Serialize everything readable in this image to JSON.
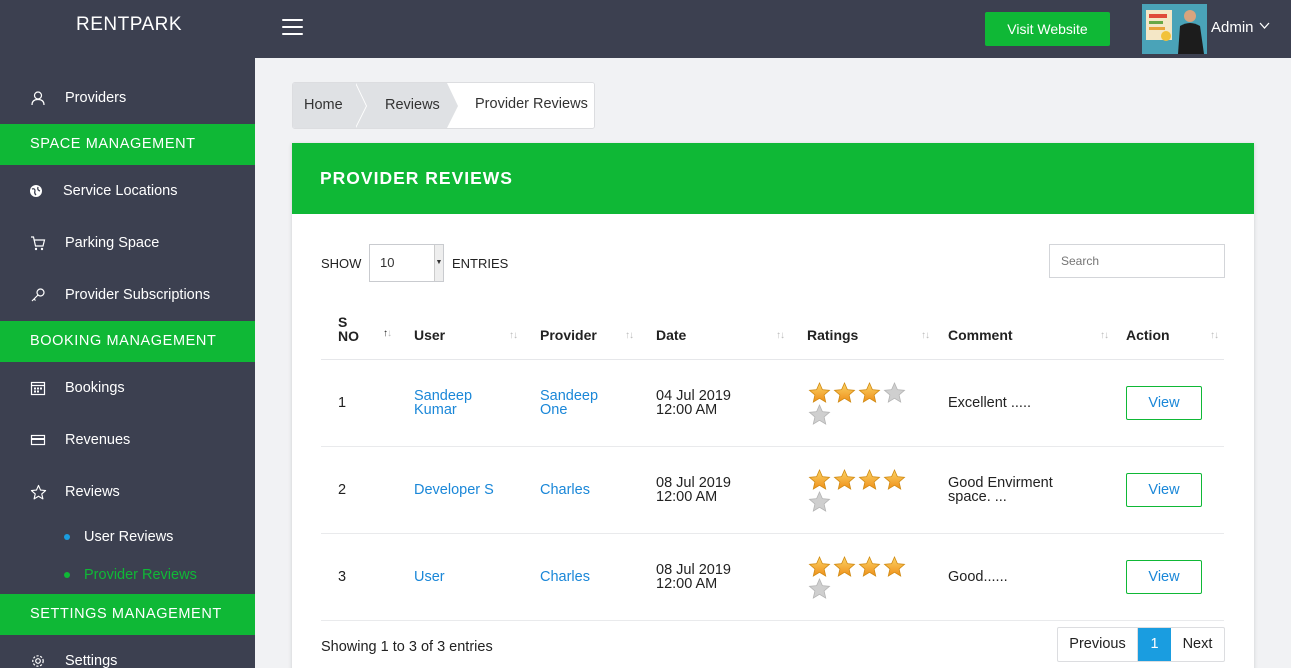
{
  "app": {
    "brand": "RENTPARK",
    "visit_label": "Visit Website",
    "user_label": "Admin"
  },
  "sidebar": {
    "providers": "Providers",
    "section_space": "SPACE MANAGEMENT",
    "service_locations": "Service Locations",
    "parking_space": "Parking Space",
    "provider_subscriptions": "Provider Subscriptions",
    "section_booking": "BOOKING MANAGEMENT",
    "bookings": "Bookings",
    "revenues": "Revenues",
    "reviews": "Reviews",
    "user_reviews": "User Reviews",
    "provider_reviews": "Provider Reviews",
    "section_settings": "SETTINGS MANAGEMENT",
    "settings": "Settings"
  },
  "breadcrumb": [
    "Home",
    "Reviews",
    "Provider Reviews"
  ],
  "card": {
    "title": "PROVIDER REVIEWS",
    "show_label": "SHOW",
    "page_size": "10",
    "entries_label": "ENTRIES",
    "search_placeholder": "Search"
  },
  "table": {
    "headers": [
      "S\nNO",
      "User",
      "Provider",
      "Date",
      "Ratings",
      "Comment",
      "Action"
    ],
    "rows": [
      {
        "sno": "1",
        "user": "Sandeep Kumar",
        "provider": "Sandeep One",
        "date": "04 Jul 2019 12:00 AM",
        "rating": 3,
        "comment": "Excellent .....",
        "action": "View"
      },
      {
        "sno": "2",
        "user": "Developer S",
        "provider": "Charles",
        "date": "08 Jul 2019 12:00 AM",
        "rating": 4,
        "comment": "Good Envirment space. ...",
        "action": "View"
      },
      {
        "sno": "3",
        "user": "User",
        "provider": "Charles",
        "date": "08 Jul 2019 12:00 AM",
        "rating": 4,
        "comment": "Good......",
        "action": "View"
      }
    ],
    "max_rating": 5
  },
  "footer": {
    "showing": "Showing 1 to 3 of 3 entries",
    "prev": "Previous",
    "page": "1",
    "next": "Next"
  },
  "colors": {
    "accent": "#0fb836",
    "sidebar": "#3c4050",
    "link": "#1a87d8",
    "star_on": "#f5a623",
    "star_off": "#c8c8c8"
  }
}
